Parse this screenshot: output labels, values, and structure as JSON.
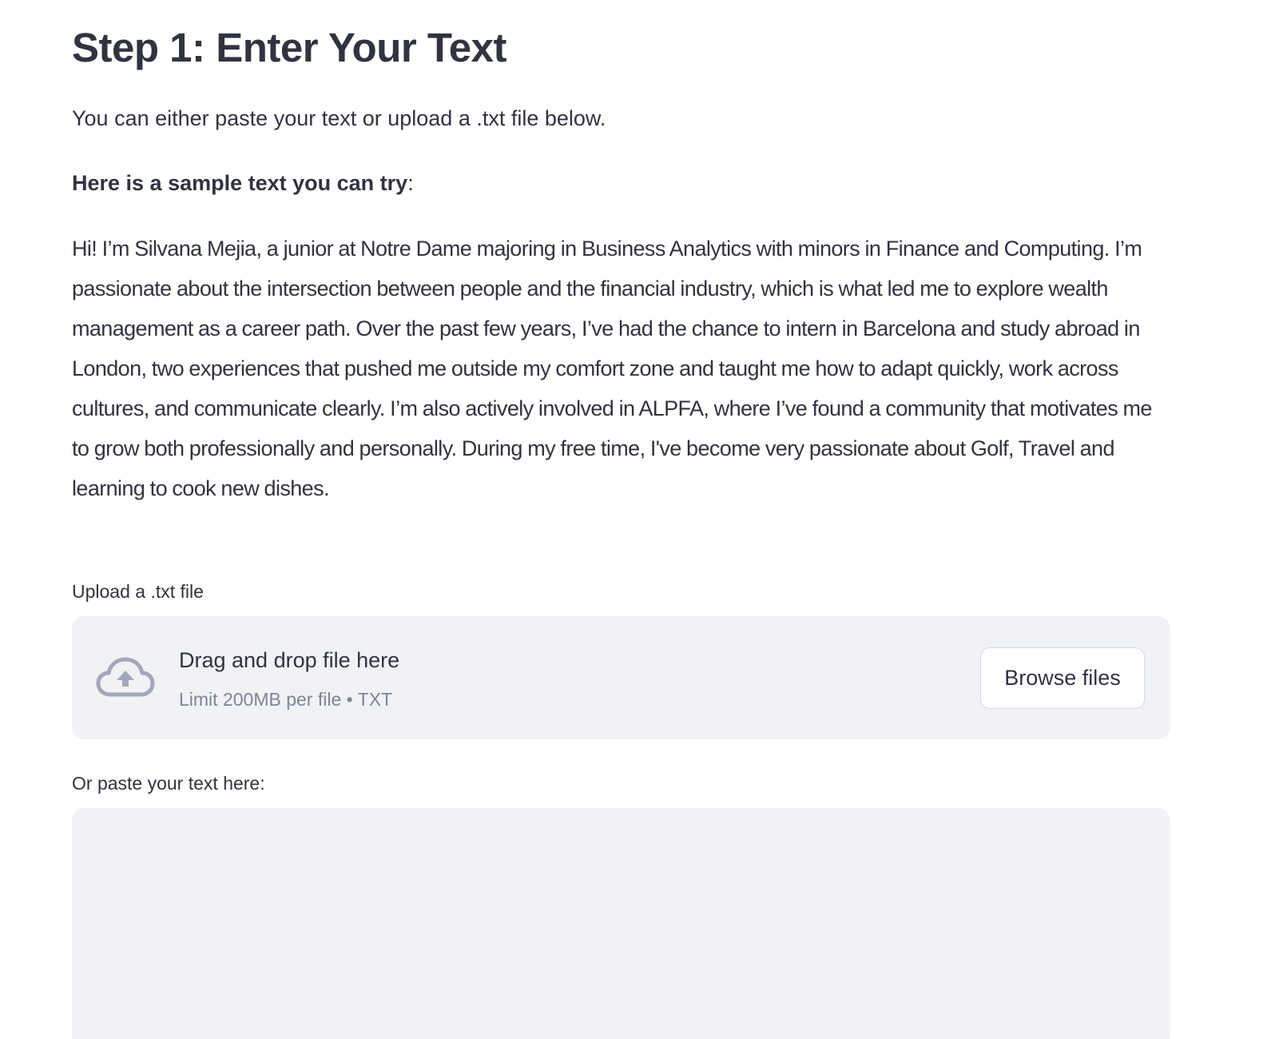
{
  "header": {
    "title": "Step 1: Enter Your Text"
  },
  "intro": "You can either paste your text or upload a .txt file below.",
  "sample": {
    "heading": "Here is a sample text you can try",
    "heading_suffix": ":",
    "text": "Hi! I’m Silvana Mejia, a junior at Notre Dame majoring in Business Analytics with minors in Finance and Computing. I’m passionate about the intersection between people and the financial industry, which is what led me to explore wealth management as a career path. Over the past few years, I’ve had the chance to intern in Barcelona and study abroad in London, two experiences that pushed me outside my comfort zone and taught me how to adapt quickly, work across cultures, and communicate clearly. I’m also actively involved in ALPFA, where I’ve found a community that motivates me to grow both professionally and personally. During my free time, I've become very passionate about Golf, Travel and learning to cook new dishes."
  },
  "uploader": {
    "label": "Upload a .txt file",
    "drop_title": "Drag and drop file here",
    "drop_limit": "Limit 200MB per file • TXT",
    "browse_label": "Browse files",
    "icon": "cloud-upload-icon"
  },
  "paste": {
    "label": "Or paste your text here:",
    "value": "",
    "placeholder": ""
  },
  "colors": {
    "text": "#31333f",
    "muted": "#808495",
    "panel": "#f0f2f6",
    "icon": "#a3a8b8"
  }
}
